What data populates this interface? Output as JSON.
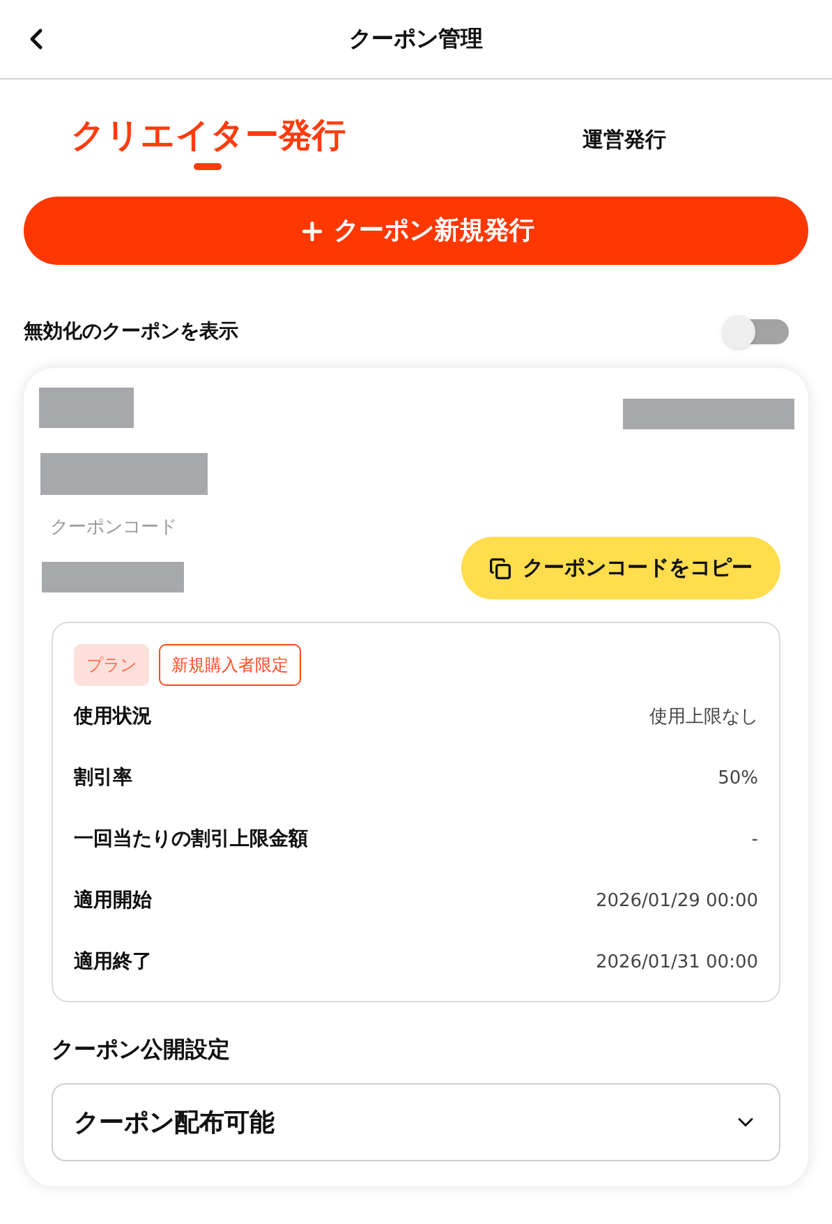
{
  "header": {
    "title": "クーポン管理"
  },
  "tabs": [
    {
      "label": "クリエイター発行",
      "selected": true
    },
    {
      "label": "運営発行",
      "selected": false
    }
  ],
  "new_button": {
    "label": "クーポン新規発行"
  },
  "show_disabled": {
    "label": "無効化のクーポンを表示",
    "on": false
  },
  "coupon": {
    "code_label": "クーポンコード",
    "copy_button": "クーポンコードをコピー",
    "tags": [
      {
        "label": "プラン",
        "kind": "filled"
      },
      {
        "label": "新規購入者限定",
        "kind": "outlined"
      }
    ],
    "details": [
      {
        "label": "使用状況",
        "value": "使用上限なし"
      },
      {
        "label": "割引率",
        "value": "50%"
      },
      {
        "label": "一回当たりの割引上限金額",
        "value": "-"
      },
      {
        "label": "適用開始",
        "value": "2026/01/29 00:00"
      },
      {
        "label": "適用終了",
        "value": "2026/01/31 00:00"
      }
    ],
    "visibility": {
      "title": "クーポン公開設定",
      "value": "クーポン配布可能"
    }
  }
}
